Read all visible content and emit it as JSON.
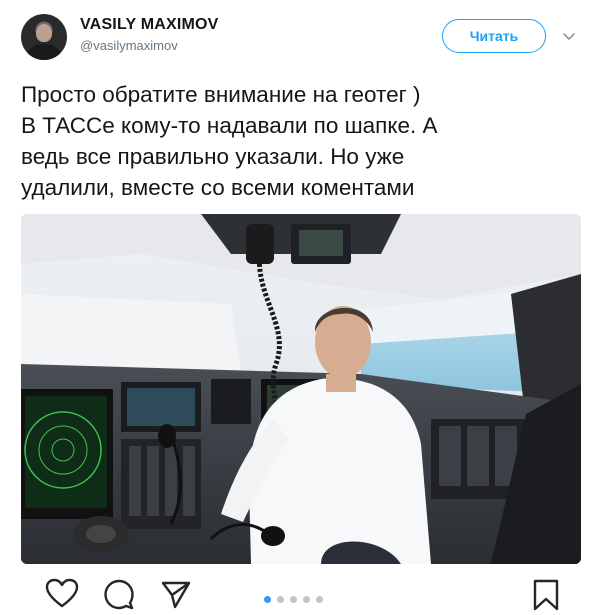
{
  "user": {
    "display_name": "VASILY MAXIMOV",
    "handle": "@vasilymaximov"
  },
  "follow_button": {
    "label": "Читать"
  },
  "tweet": {
    "text": "Просто обратите внимание на геотег )\nВ ТАССе кому-то надавали по шапке. А\nведь все правильно указали. Но уже\nудалили, вместе со всеми коментами"
  },
  "carousel": {
    "total": 5,
    "active_index": 0
  },
  "icons": {
    "like": "heart-icon",
    "comment": "comment-icon",
    "share": "send-icon",
    "save": "bookmark-icon",
    "menu": "chevron-down-icon"
  },
  "colors": {
    "accent": "#1da1f2",
    "carousel_active": "#3897f0"
  }
}
